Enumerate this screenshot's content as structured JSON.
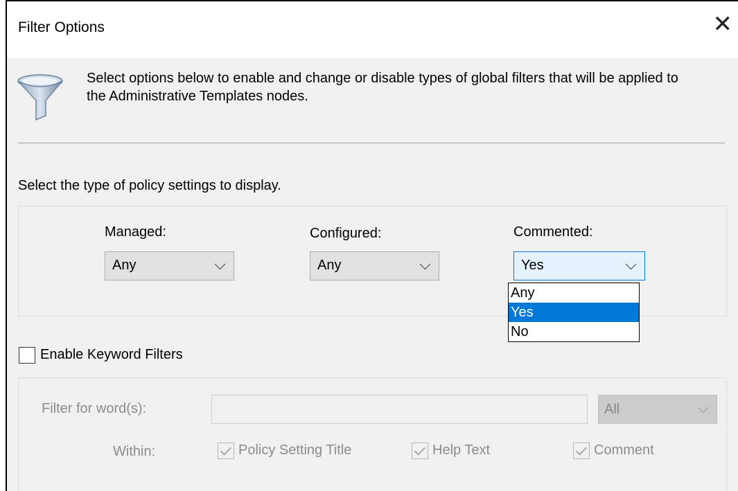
{
  "dialog": {
    "title": "Filter Options",
    "close_glyph": "✕",
    "icon": "funnel-icon",
    "intro_text": "Select options below to enable and change or disable types of global filters that will be applied to the Administrative Templates nodes."
  },
  "policy_type": {
    "label": "Select the type of policy settings to display.",
    "managed": {
      "label": "Managed:",
      "value": "Any"
    },
    "configured": {
      "label": "Configured:",
      "value": "Any"
    },
    "commented": {
      "label": "Commented:",
      "value": "Yes",
      "options": [
        "Any",
        "Yes",
        "No"
      ],
      "highlighted": "Yes"
    }
  },
  "keyword": {
    "enable_label": "Enable Keyword Filters",
    "enabled": false,
    "filter_label": "Filter for word(s):",
    "filter_value": "",
    "scope_value": "All",
    "within_label": "Within:",
    "policy_title_label": "Policy Setting Title",
    "help_text_label": "Help Text",
    "comment_label": "Comment"
  },
  "colors": {
    "accent": "#0078d7",
    "disabled_text": "#8c8c8c",
    "dialog_bg": "#f0f0f0"
  }
}
